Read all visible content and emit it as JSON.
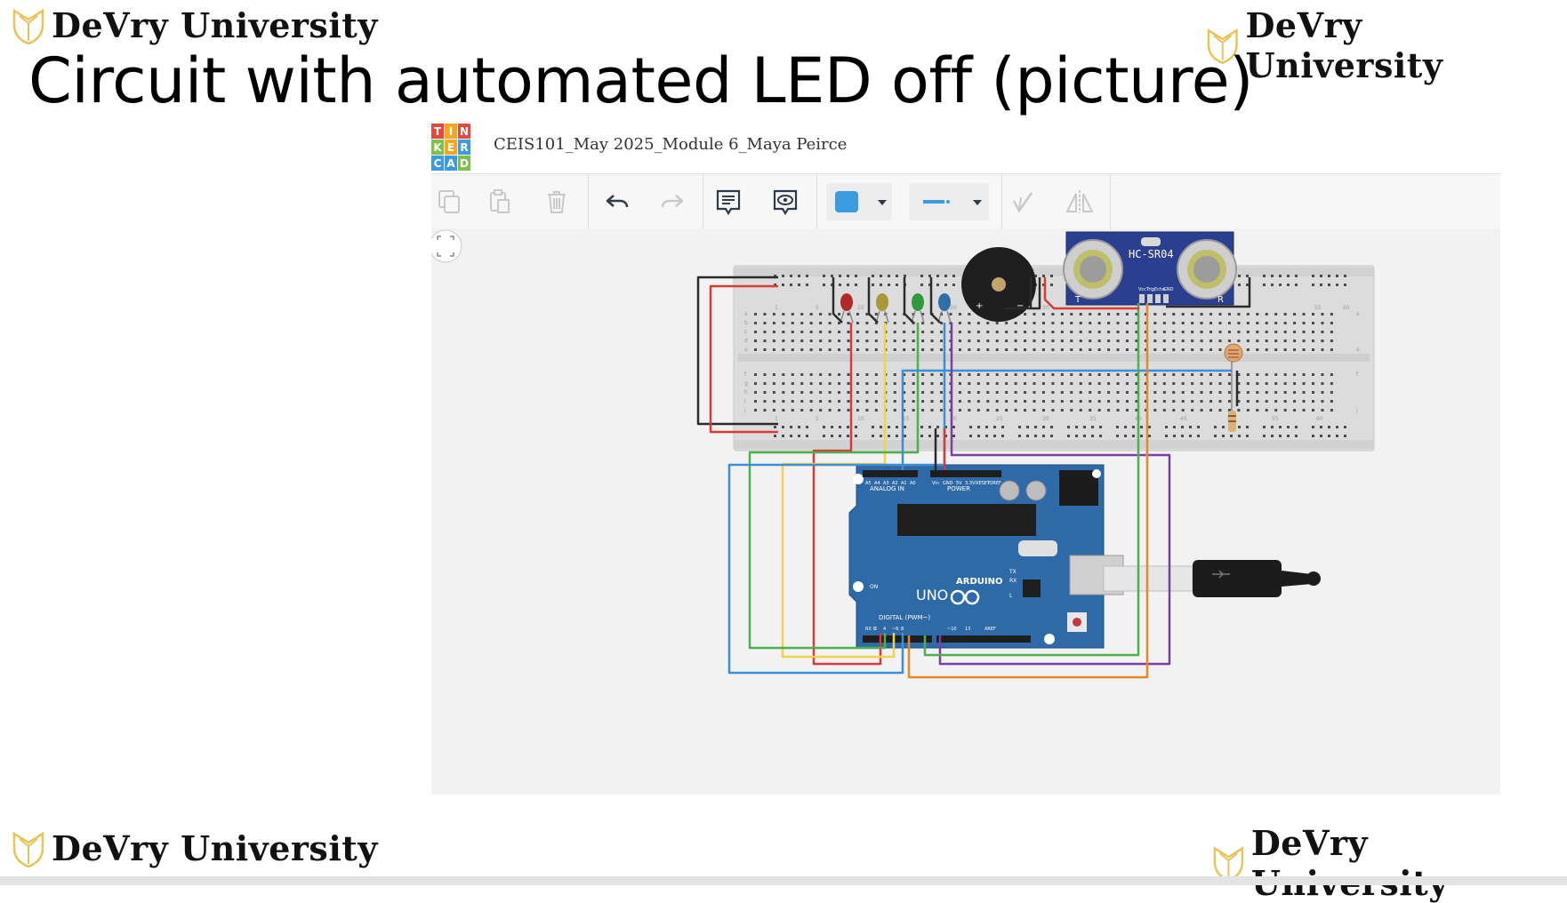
{
  "branding": {
    "university_name": "DeVry University",
    "accent_color": "#E8C35A"
  },
  "slide": {
    "title": "Circuit with automated LED off (picture)"
  },
  "tinkercad": {
    "logo_letters": [
      "T",
      "I",
      "N",
      "K",
      "E",
      "R",
      "C",
      "A",
      "D"
    ],
    "design_title": "CEIS101_May 2025_Module 6_Maya Peirce",
    "toolbar_icons": [
      "copy-icon",
      "paste-icon",
      "trash-icon",
      "undo-icon",
      "redo-icon",
      "notes-icon",
      "notes-visibility-icon",
      "fill-color-swatch",
      "line-style-picker",
      "flip-disabled-icon",
      "mirror-icon"
    ],
    "fill_color": "#3b9be0",
    "components": {
      "sensor_label": "HC-SR04",
      "sensor_pins": [
        "Vcc",
        "Trig",
        "Echo",
        "GND"
      ],
      "sensor_marks": [
        "T",
        "R"
      ],
      "board_brand": "ARDUINO",
      "board_model": "UNO",
      "header_analog": "ANALOG IN",
      "header_power": "POWER",
      "header_digital": "DIGITAL (PWM~)",
      "board_on_label": "ON",
      "board_tx": "TX",
      "board_rx": "RX",
      "board_l": "L",
      "analog_pins": [
        "A0",
        "A1",
        "A2",
        "A3",
        "A4",
        "A5"
      ],
      "power_pins": [
        "Vin",
        "GND",
        "GND",
        "5V",
        "3.3V",
        "RESET",
        "IOREF"
      ],
      "digital_pins": [
        "AREF",
        "GND",
        "13",
        "12",
        "~11",
        "~10",
        "~9",
        "8",
        "7",
        "~6",
        "~5",
        "4",
        "~3",
        "2",
        "TX 1",
        "RX 0"
      ],
      "breadboard_rows": [
        "a",
        "b",
        "c",
        "d",
        "e",
        "f",
        "g",
        "h",
        "i",
        "j"
      ],
      "breadboard_cols": [
        "1",
        "5",
        "10",
        "15",
        "20",
        "25",
        "30",
        "35",
        "40",
        "45",
        "50",
        "55",
        "60"
      ],
      "buzzer_plus": "+",
      "buzzer_minus": "−"
    },
    "led_colors": [
      "#b02a2a",
      "#a89a3a",
      "#2e9a3c",
      "#2f6fa8"
    ],
    "wire_colors": {
      "red": "#d83a3a",
      "black": "#2b2b2b",
      "green": "#4caf50",
      "yellow": "#f2d24a",
      "blue": "#3a8fd6",
      "purple": "#7b3fa0",
      "orange": "#e8872a"
    }
  }
}
